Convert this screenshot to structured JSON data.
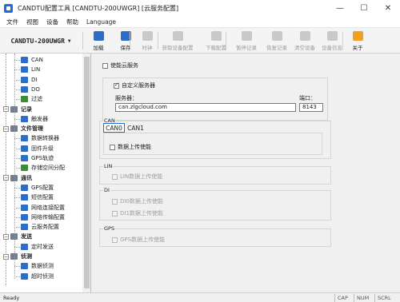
{
  "window": {
    "title": "CANDTU配置工具 [CANDTU-200UWGR] [云服务配置]",
    "controls": [
      "—",
      "☐",
      "✕"
    ]
  },
  "menu": [
    "文件",
    "视图",
    "设备",
    "帮助",
    "Language"
  ],
  "toolbar": {
    "device_selector": "CANDTU-200UWGR",
    "buttons": [
      {
        "label": "加载",
        "icon": "load-icon",
        "enabled": true,
        "color": "#2c6fc9"
      },
      {
        "label": "保存",
        "icon": "save-icon",
        "enabled": true,
        "color": "#2c6fc9"
      },
      {
        "label": "时钟",
        "icon": "clock-icon",
        "enabled": false
      },
      {
        "label": "获取设备配置",
        "icon": "get-config-icon",
        "enabled": false
      },
      {
        "label": "下载配置",
        "icon": "download-config-icon",
        "enabled": false
      },
      {
        "label": "暂停记录",
        "icon": "pause-record-icon",
        "enabled": false
      },
      {
        "label": "恢复记录",
        "icon": "resume-record-icon",
        "enabled": false
      },
      {
        "label": "清空设备",
        "icon": "clear-device-icon",
        "enabled": false
      },
      {
        "label": "设备信息",
        "icon": "device-info-icon",
        "enabled": false
      },
      {
        "label": "关于",
        "icon": "about-icon",
        "enabled": true,
        "color": "#f0a020"
      }
    ]
  },
  "sidebar": {
    "items": [
      {
        "label": "CAN",
        "icon": "can-icon",
        "level": 2,
        "kind": "leaf"
      },
      {
        "label": "LIN",
        "icon": "lin-icon",
        "level": 2,
        "kind": "leaf"
      },
      {
        "label": "DI",
        "icon": "di-icon",
        "level": 2,
        "kind": "leaf"
      },
      {
        "label": "DO",
        "icon": "do-icon",
        "level": 2,
        "kind": "leaf"
      },
      {
        "label": "过滤",
        "icon": "filter-icon",
        "level": 2,
        "kind": "leaf"
      },
      {
        "label": "记录",
        "icon": "record-icon",
        "level": 1,
        "kind": "group"
      },
      {
        "label": "触发器",
        "icon": "trigger-icon",
        "level": 2,
        "kind": "leaf"
      },
      {
        "label": "文件管理",
        "icon": "file-management-icon",
        "level": 1,
        "kind": "group"
      },
      {
        "label": "数据转换器",
        "icon": "data-converter-icon",
        "level": 2,
        "kind": "leaf"
      },
      {
        "label": "固件升级",
        "icon": "firmware-upgrade-icon",
        "level": 2,
        "kind": "leaf"
      },
      {
        "label": "GPS轨迹",
        "icon": "gps-track-icon",
        "level": 2,
        "kind": "leaf"
      },
      {
        "label": "存储空间分配",
        "icon": "storage-allocation-icon",
        "level": 2,
        "kind": "leaf"
      },
      {
        "label": "通讯",
        "icon": "communication-icon",
        "level": 1,
        "kind": "group"
      },
      {
        "label": "GPS配置",
        "icon": "gps-config-icon",
        "level": 2,
        "kind": "leaf"
      },
      {
        "label": "短信配置",
        "icon": "sms-config-icon",
        "level": 2,
        "kind": "leaf"
      },
      {
        "label": "网络连接配置",
        "icon": "network-connection-icon",
        "level": 2,
        "kind": "leaf"
      },
      {
        "label": "网络传输配置",
        "icon": "network-transfer-icon",
        "level": 2,
        "kind": "leaf"
      },
      {
        "label": "云服务配置",
        "icon": "cloud-service-icon",
        "level": 2,
        "kind": "leaf"
      },
      {
        "label": "发送",
        "icon": "send-icon",
        "level": 1,
        "kind": "group"
      },
      {
        "label": "定时发送",
        "icon": "timed-send-icon",
        "level": 2,
        "kind": "leaf"
      },
      {
        "label": "侦测",
        "icon": "detect-icon",
        "level": 1,
        "kind": "group"
      },
      {
        "label": "数据侦测",
        "icon": "data-detect-icon",
        "level": 2,
        "kind": "leaf"
      },
      {
        "label": "超时侦测",
        "icon": "timeout-detect-icon",
        "level": 2,
        "kind": "leaf"
      }
    ]
  },
  "content": {
    "enable_cloud": {
      "label": "使能云服务",
      "checked": false
    },
    "custom_server": {
      "label": "自定义服务器",
      "checked": true
    },
    "server_label": "服务器：",
    "server_value": "can.zlgcloud.com",
    "port_label": "端口：",
    "port_value": "8143",
    "can_section": {
      "title": "CAN",
      "tabs": [
        "CAN0",
        "CAN1"
      ],
      "upload_label": "数据上传使能"
    },
    "lin_section": {
      "title": "LIN",
      "items": [
        "LIN数据上传使能"
      ]
    },
    "di_section": {
      "title": "DI",
      "items": [
        "DI0数据上传使能",
        "DI1数据上传使能"
      ]
    },
    "gps_section": {
      "title": "GPS",
      "items": [
        "GPS数据上传使能"
      ]
    }
  },
  "status": {
    "ready": "Ready",
    "indicators": [
      "CAP",
      "NUM",
      "SCRL"
    ]
  }
}
